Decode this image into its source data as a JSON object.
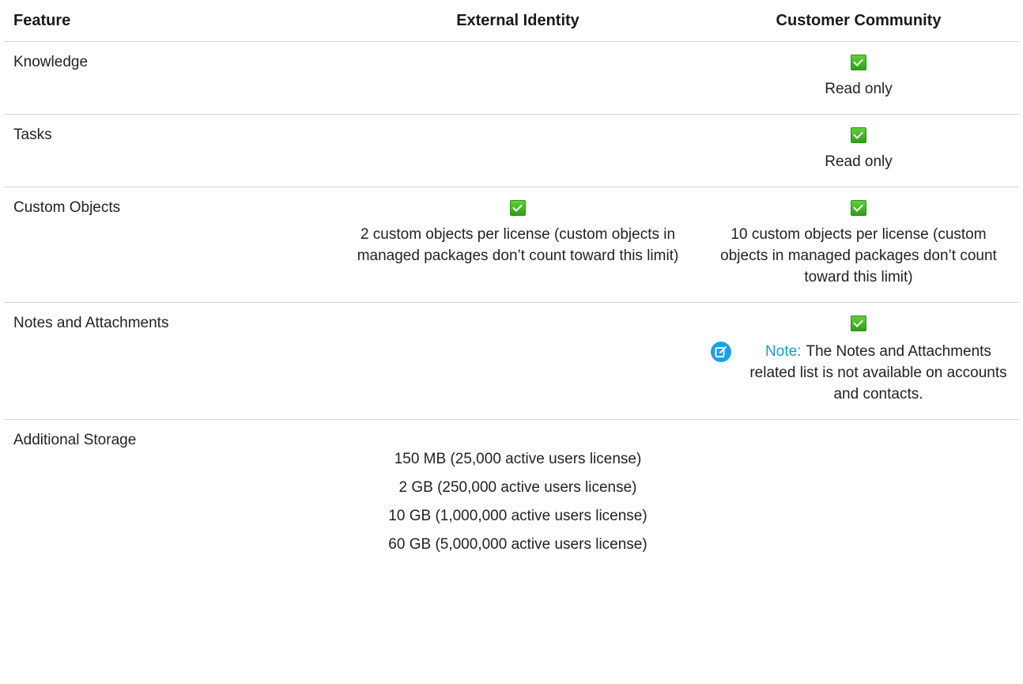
{
  "table": {
    "headers": {
      "feature": "Feature",
      "external": "External Identity",
      "customer": "Customer Community"
    },
    "rows": [
      {
        "feature": "Knowledge",
        "external": {
          "check": false,
          "text": []
        },
        "customer": {
          "check": true,
          "text": [
            "Read only"
          ]
        }
      },
      {
        "feature": "Tasks",
        "external": {
          "check": false,
          "text": []
        },
        "customer": {
          "check": true,
          "text": [
            "Read only"
          ]
        }
      },
      {
        "feature": "Custom Objects",
        "external": {
          "check": true,
          "text": [
            "2 custom objects per license (custom objects in managed packages don’t count toward this limit)"
          ]
        },
        "customer": {
          "check": true,
          "text": [
            "10 custom objects per license (custom objects in managed packages don’t count toward this limit)"
          ]
        }
      },
      {
        "feature": "Notes and Attachments",
        "external": {
          "check": false,
          "text": []
        },
        "customer": {
          "check": true,
          "note": {
            "label": "Note:",
            "text": "The Notes and Attachments related list is not available on accounts and contacts."
          }
        }
      },
      {
        "feature": "Additional Storage",
        "external": {
          "check": false,
          "storage": [
            "150 MB (25,000 active users license)",
            "2 GB (250,000 active users license)",
            "10 GB (1,000,000 active users license)",
            "60 GB (5,000,000 active users license)"
          ]
        },
        "customer": {
          "check": false,
          "text": []
        }
      }
    ]
  },
  "icons": {
    "check": "checkbox-checked-icon",
    "note": "note-edit-icon"
  },
  "colors": {
    "check_green": "#3cb521",
    "note_blue": "#1aa3e8",
    "note_label": "#1a9ad6",
    "divider": "#d6d6d6"
  }
}
